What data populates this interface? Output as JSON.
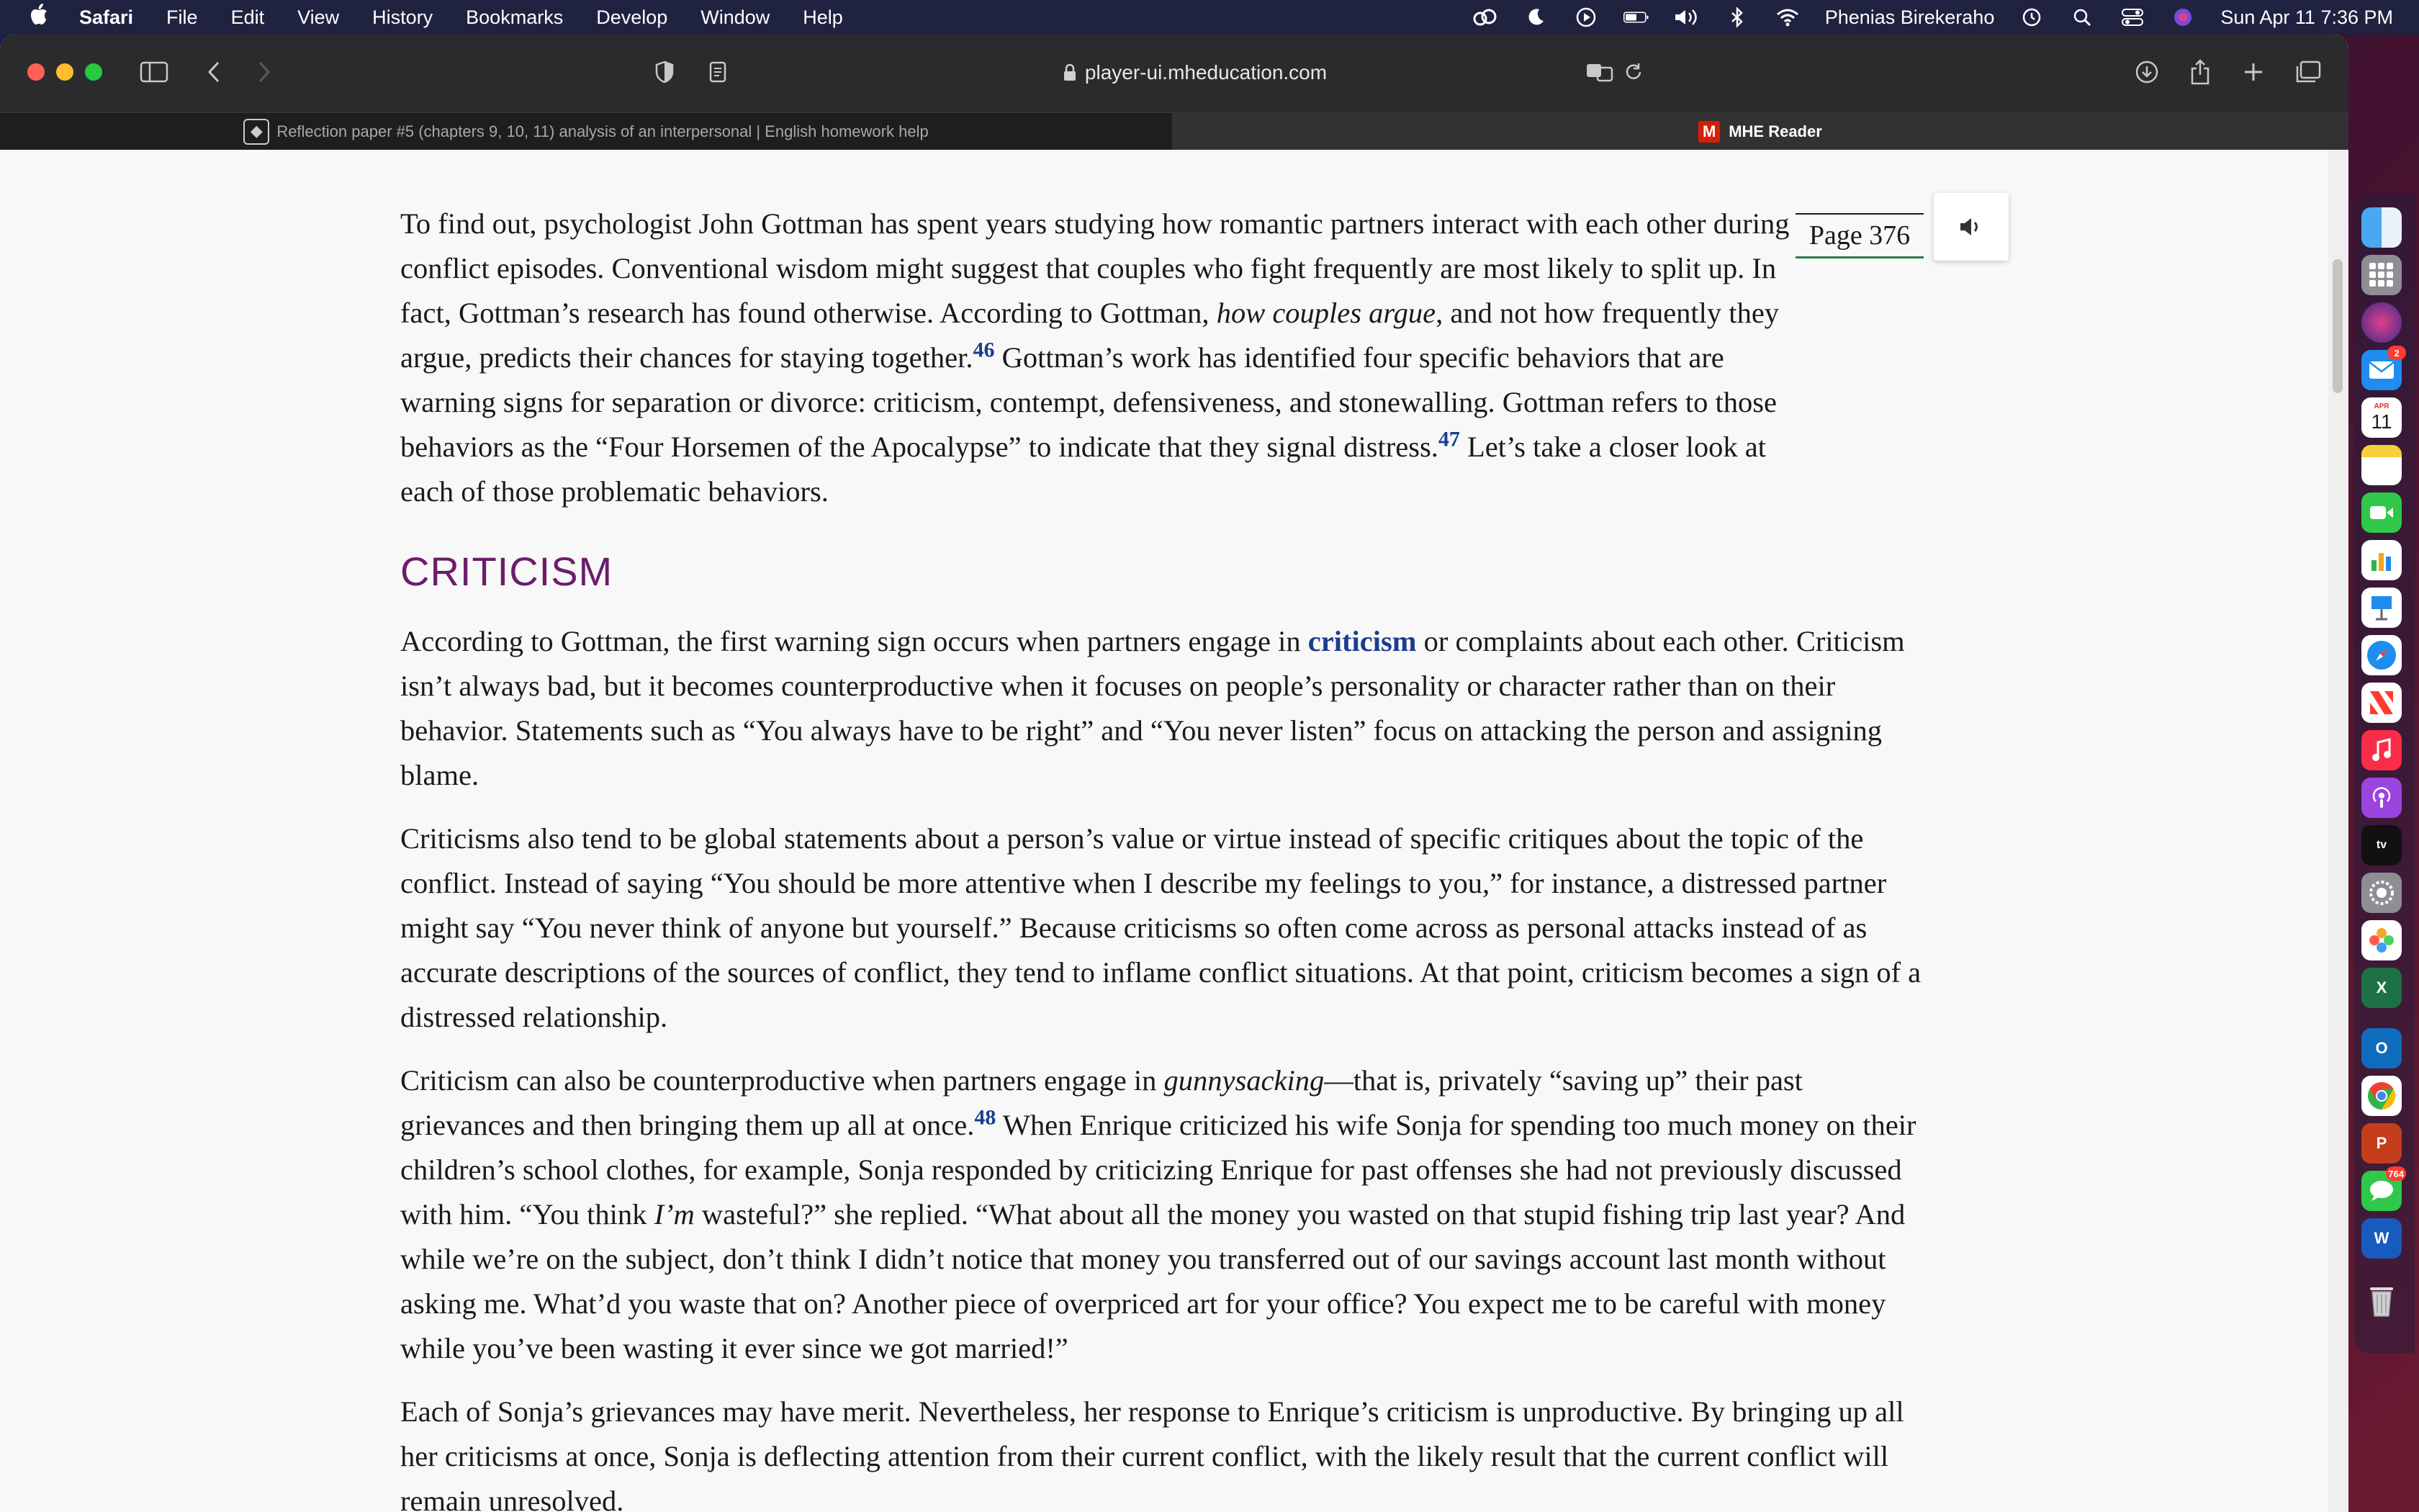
{
  "menubar": {
    "app": "Safari",
    "items": [
      "File",
      "Edit",
      "View",
      "History",
      "Bookmarks",
      "Develop",
      "Window",
      "Help"
    ],
    "user": "Phenias Birekeraho",
    "datetime": "Sun Apr 11  7:36 PM"
  },
  "browser": {
    "url": "player-ui.mheducation.com",
    "tabs": [
      {
        "title": "Reflection paper #5 (chapters 9, 10, 11) analysis of an interpersonal | English homework help",
        "active": false
      },
      {
        "title": "MHE Reader",
        "active": true,
        "logo": "M"
      }
    ]
  },
  "reader": {
    "page_label": "Page 376",
    "paragraphs": {
      "p1a": "To find out, psychologist John Gottman has spent years studying how romantic partners interact with each other during conflict episodes. Conventional wisdom might suggest that couples who fight frequently are most likely to split up. In fact, Gottman’s research has found otherwise. According to Gottman, ",
      "p1_em": "how couples argue",
      "p1b": ", and not how frequently they argue, predicts their chances for staying together.",
      "p1_ref1": "46",
      "p1c": " Gottman’s work has identified four specific behaviors that are warning signs for separation or divorce: criticism, contempt, defensiveness, and stonewalling. Gottman refers to those behaviors as the “Four Horsemen of the Apocalypse” to indicate that they signal distress.",
      "p1_ref2": "47",
      "p1d": " Let’s take a closer look at each of those problematic behaviors.",
      "heading": "CRITICISM",
      "p2a": "According to Gottman, the first warning sign occurs when partners engage in ",
      "p2_term": "criticism",
      "p2b": " or complaints about each other. Criticism isn’t always bad, but it becomes counterproductive when it focuses on people’s personality or character rather than on their behavior. Statements such as “You always have to be right” and “You never listen” focus on attacking the person and assigning blame.",
      "p3": "Criticisms also tend to be global statements about a person’s value or virtue instead of specific critiques about the topic of the conflict. Instead of saying “You should be more attentive when I describe my feelings to you,” for instance, a distressed partner might say “You never think of anyone but yourself.” Because criticisms so often come across as personal attacks instead of as accurate descriptions of the sources of conflict, they tend to inflame conflict situations. At that point, criticism becomes a sign of a distressed relationship.",
      "p4a": "Criticism can also be counterproductive when partners engage in ",
      "p4_em": "gunnysacking",
      "p4b": "—that is, privately “saving up” their past grievances and then bringing them up all at once.",
      "p4_ref": "48",
      "p4c": " When Enrique criticized his wife Sonja for spending too much money on their children’s school clothes, for example, Sonja responded by criticizing Enrique for past offenses she had not previously discussed with him. “You think ",
      "p4_em2": "I’m",
      "p4d": " wasteful?” she replied. “What about all the money you wasted on that stupid fishing trip last year? And while we’re on the subject, don’t think I didn’t notice that money you transferred out of our savings account last month without asking me. What’d you waste that on? Another piece of overpriced art for your office? You expect me to be careful with money while you’ve been wasting it ever since we got married!”",
      "p5": "Each of Sonja’s grievances may have merit. Nevertheless, her response to Enrique’s criticism is unproductive. By bringing up all her criticisms at once, Sonja is deflecting attention from their current conflict, with the likely result that the current conflict will remain unresolved."
    }
  },
  "dock": {
    "calendar_month": "APR",
    "calendar_day": "11",
    "mail_badge": "2",
    "messages_badge": "764",
    "apps": [
      "finder-icon",
      "launchpad-icon",
      "siri-icon",
      "mail-icon",
      "calendar-icon",
      "notes-icon",
      "facetime-icon",
      "numbers-icon",
      "keynote-icon",
      "safari-icon",
      "news-icon",
      "music-icon",
      "podcasts-icon",
      "tv-icon",
      "system-preferences-icon",
      "photos-icon",
      "excel-icon",
      "outlook-icon",
      "chrome-icon",
      "powerpoint-icon",
      "messages-icon",
      "word-icon",
      "trash-icon"
    ]
  },
  "colors": {
    "heading": "#6b1d6b",
    "term_link": "#1b3d8f",
    "page_rule": "#2d7a4a",
    "mhe_red": "#d81e05"
  }
}
